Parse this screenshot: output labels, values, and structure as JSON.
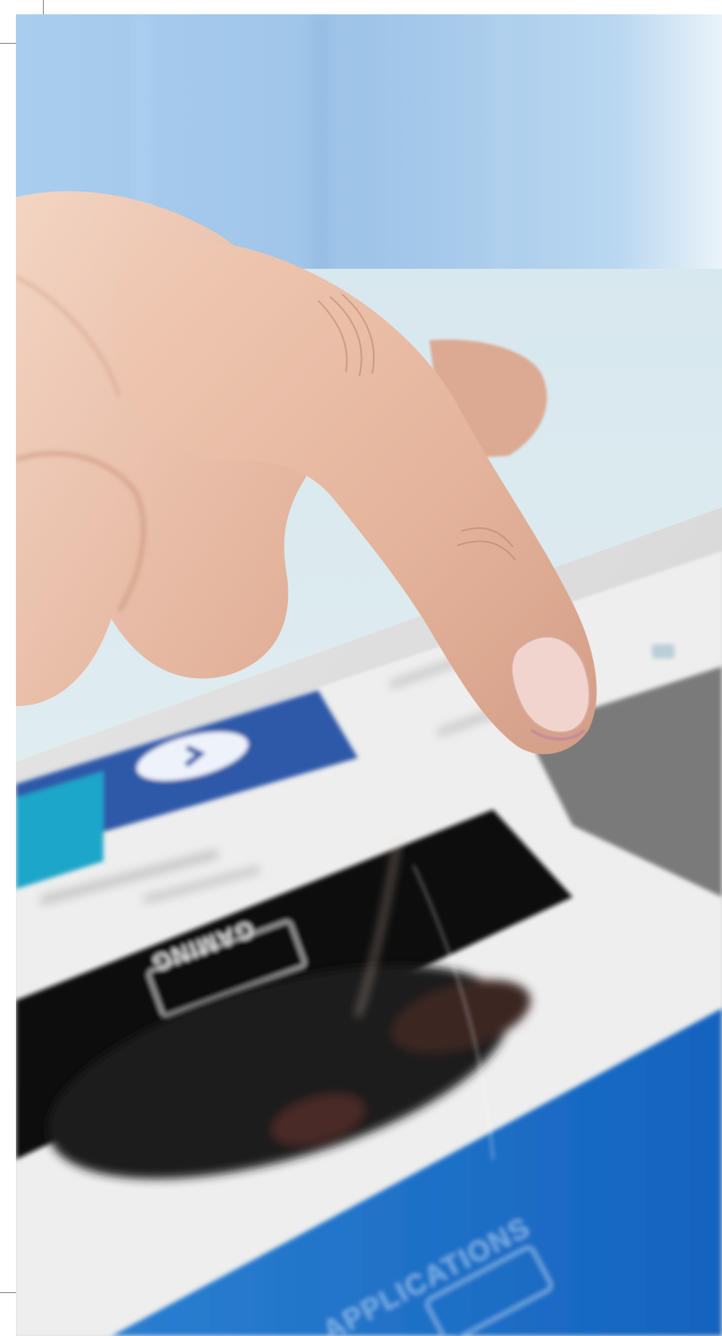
{
  "photo": {
    "subject": "hand-touching-tablet",
    "colors": {
      "shirt": "#9ec4e8",
      "shirt_light": "#c3ddf2",
      "table": "#dbe9ee",
      "skin": "#e7b9a2",
      "skin_shadow": "#c98f78",
      "nail": "#efd2cc",
      "tablet_frame": "#d9d9d9",
      "tile_blue": "#2f58a8",
      "tile_cyan": "#1ea6c9",
      "tile_black": "#111111",
      "banner_blue": "#1769c4"
    }
  },
  "tablet_screen": {
    "tile_text_top": "GAMING",
    "tile_text_bottom": "APPLICATIONS"
  }
}
